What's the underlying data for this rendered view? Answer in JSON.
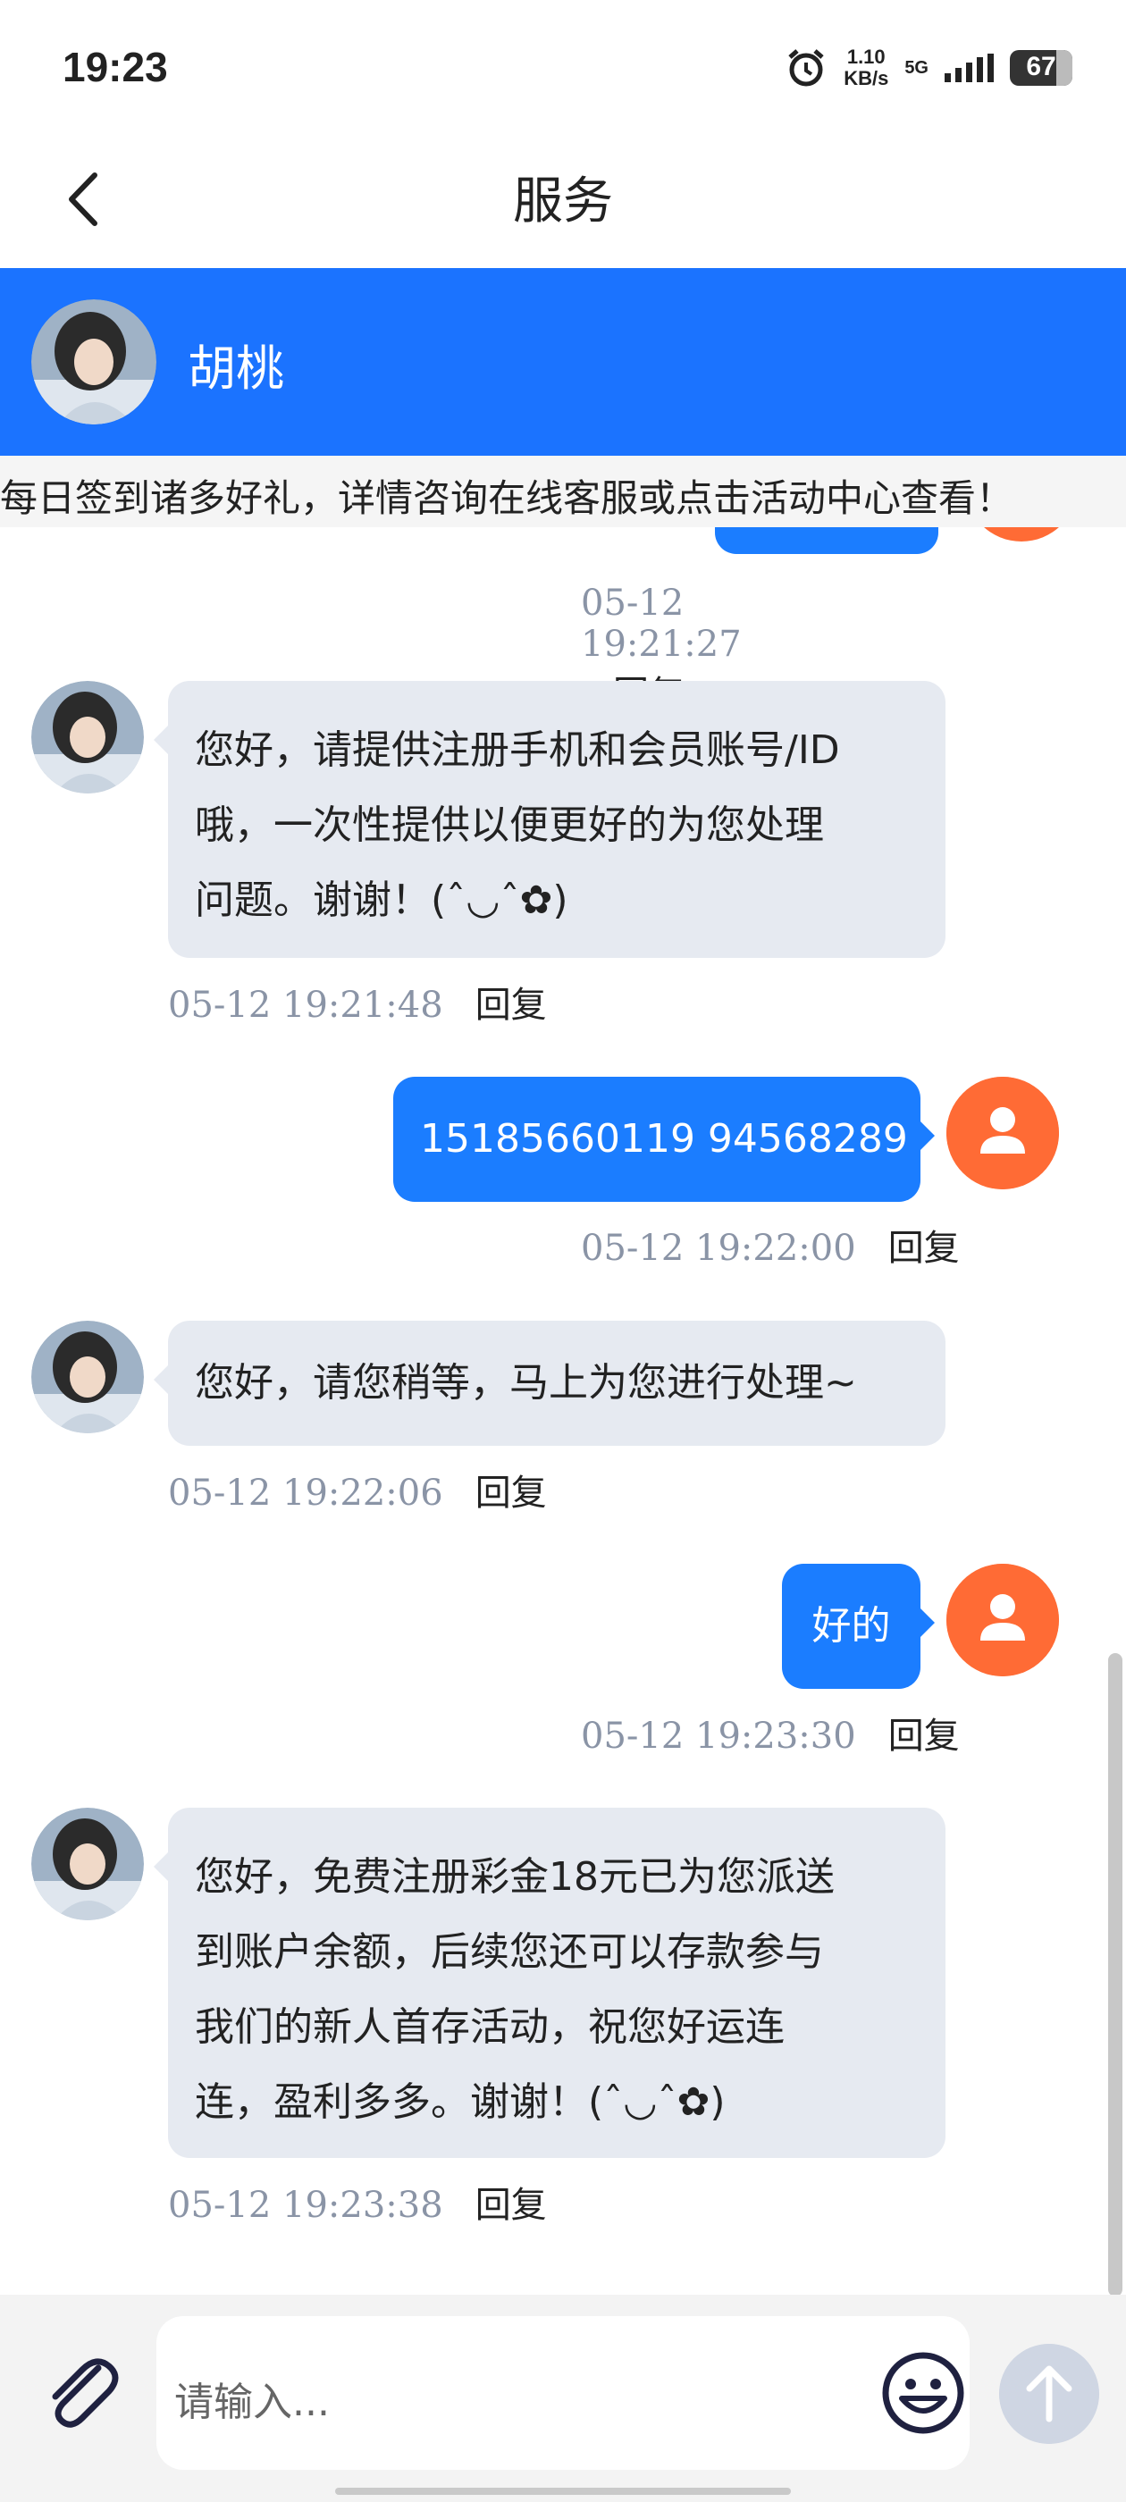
{
  "status": {
    "time": "19:23",
    "speed_value": "1.10",
    "speed_unit": "KB/s",
    "network": "5G",
    "battery": "67"
  },
  "header": {
    "title": "服务"
  },
  "agent": {
    "name": "胡桃"
  },
  "notice": {
    "text": "每日签到诸多好礼，详情咨询在线客服或点击活动中心查看！"
  },
  "messages": [
    {
      "from": "user",
      "time": "05-12 19:21:27",
      "reply": "回复"
    },
    {
      "from": "agent",
      "lines": [
        "您好，请提供注册手机和会员账号/ID",
        "哦，一次性提供以便更好的为您处理",
        "问题。谢谢！(ˆ◡ˆ✿)"
      ],
      "time": "05-12 19:21:48",
      "reply": "回复"
    },
    {
      "from": "user",
      "text": "15185660119 94568289",
      "time": "05-12 19:22:00",
      "reply": "回复"
    },
    {
      "from": "agent",
      "lines": [
        "您好，请您稍等，马上为您进行处理~"
      ],
      "time": "05-12 19:22:06",
      "reply": "回复"
    },
    {
      "from": "user",
      "text": "好的",
      "time": "05-12 19:23:30",
      "reply": "回复"
    },
    {
      "from": "agent",
      "lines": [
        "您好，免费注册彩金18元已为您派送",
        "到账户余额，后续您还可以存款参与",
        "我们的新人首存活动，祝您好运连",
        "连，盈利多多。谢谢！(ˆ◡ˆ✿)"
      ],
      "time": "05-12 19:23:38",
      "reply": "回复"
    }
  ],
  "input": {
    "placeholder": "请输入..."
  },
  "icons": {
    "back": "back-arrow-icon",
    "attach": "paperclip-icon",
    "emoji": "smiley-icon",
    "send": "arrow-up-icon",
    "user_avatar": "person-icon"
  },
  "colors": {
    "primary": "#1b73ff",
    "user_avatar": "#ff6b35",
    "agent_bubble": "#e6eaf1"
  }
}
